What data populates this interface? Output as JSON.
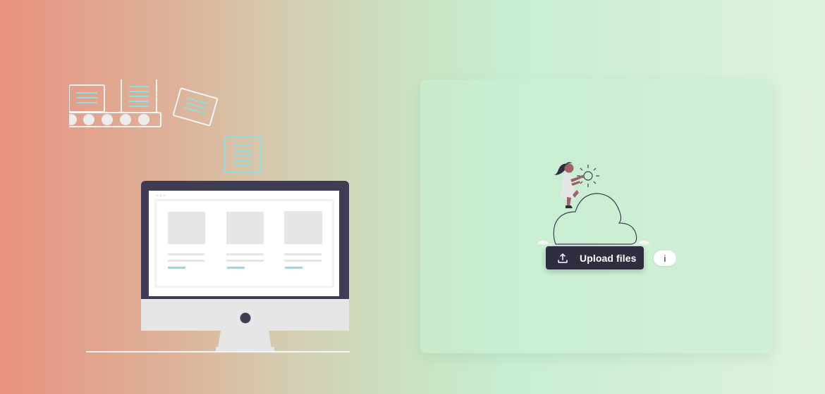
{
  "upload": {
    "button_label": "Upload files",
    "info_label": "i",
    "icon": "upload-icon"
  },
  "colors": {
    "button_bg": "#2f2e41",
    "accent_teal": "#8de0de",
    "monitor_frame": "#3f3d56",
    "placeholder_gray": "#e6e6e6"
  }
}
